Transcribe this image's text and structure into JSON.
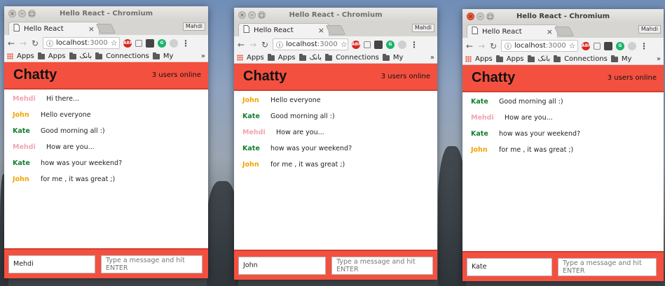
{
  "brand_color": "#f4503f",
  "user_colors": {
    "Mehdi": "#f0a5b2",
    "John": "#f0a400",
    "Kate": "#127f2f"
  },
  "windows": [
    {
      "title": "Hello React - Chromium",
      "tab_label": "Hello React",
      "profile": "Mahdi",
      "url_host": "localhost",
      "url_port": ":3000",
      "bookmarks": [
        "Apps",
        "Apps",
        "بانک",
        "Connections",
        "My"
      ],
      "brand": "Chatty",
      "online": "3 users online",
      "messages": [
        {
          "user": "Mehdi",
          "content": "Hi there..."
        },
        {
          "user": "John",
          "content": "Hello everyone"
        },
        {
          "user": "Kate",
          "content": "Good morning all :)"
        },
        {
          "user": "Mehdi",
          "content": "How are you..."
        },
        {
          "user": "Kate",
          "content": "how was your weekend?"
        },
        {
          "user": "John",
          "content": "for me , it was great ;)"
        }
      ],
      "username_value": "Mehdi",
      "message_placeholder": "Type a message and hit ENTER"
    },
    {
      "title": "Hello React - Chromium",
      "tab_label": "Hello React",
      "profile": "Mahdi",
      "url_host": "localhost",
      "url_port": ":3000",
      "bookmarks": [
        "Apps",
        "Apps",
        "بانک",
        "Connections",
        "My"
      ],
      "brand": "Chatty",
      "online": "3 users online",
      "messages": [
        {
          "user": "John",
          "content": "Hello everyone"
        },
        {
          "user": "Kate",
          "content": "Good morning all :)"
        },
        {
          "user": "Mehdi",
          "content": "How are you..."
        },
        {
          "user": "Kate",
          "content": "how was your weekend?"
        },
        {
          "user": "John",
          "content": "for me , it was great ;)"
        }
      ],
      "username_value": "John",
      "message_placeholder": "Type a message and hit ENTER"
    },
    {
      "title": "Hello React - Chromium",
      "tab_label": "Hello React",
      "profile": "Mahdi",
      "url_host": "localhost",
      "url_port": ":3000",
      "bookmarks": [
        "Apps",
        "Apps",
        "بانک",
        "Connections",
        "My"
      ],
      "brand": "Chatty",
      "online": "3 users online",
      "messages": [
        {
          "user": "Kate",
          "content": "Good morning all :)"
        },
        {
          "user": "Mehdi",
          "content": "How are you..."
        },
        {
          "user": "Kate",
          "content": "how was your weekend?"
        },
        {
          "user": "John",
          "content": "for me , it was great ;)"
        }
      ],
      "username_value": "Kate",
      "message_placeholder": "Type a message and hit ENTER"
    }
  ]
}
